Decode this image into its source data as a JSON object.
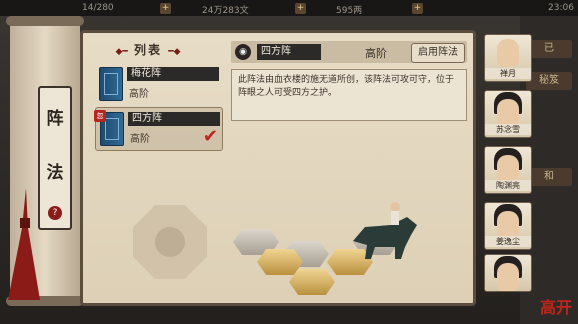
{
  "topbar": {
    "left_value": "14/280",
    "middle_value": "24万283文",
    "right_value": "595两",
    "time": "23:06"
  },
  "right_strip": {
    "buttons": [
      "已",
      "秘笈",
      "和"
    ]
  },
  "scroll": {
    "title_chars": [
      "阵",
      "法"
    ],
    "help": "?"
  },
  "list": {
    "title": "列表",
    "items": [
      {
        "name": "梅花阵",
        "rank": "高阶",
        "selected": false,
        "new": false
      },
      {
        "name": "四方阵",
        "rank": "高阶",
        "selected": true,
        "new": true,
        "new_label": "忽"
      }
    ]
  },
  "detail": {
    "name": "四方阵",
    "rank": "高阶",
    "enable_label": "启用阵法",
    "description": "此阵法由血衣楼的施无道所创，该阵法可攻可守，位于阵眼之人可受四方之护。"
  },
  "portraits": [
    {
      "name": "禅月",
      "icon": "monk-portrait"
    },
    {
      "name": "苏念雪",
      "icon": "woman-portrait"
    },
    {
      "name": "陶渊亮",
      "icon": "man-portrait"
    },
    {
      "name": "姜逸尘",
      "icon": "blindfold-portrait"
    },
    {
      "name": "",
      "icon": "woman-portrait-2"
    }
  ],
  "logo": "高开"
}
